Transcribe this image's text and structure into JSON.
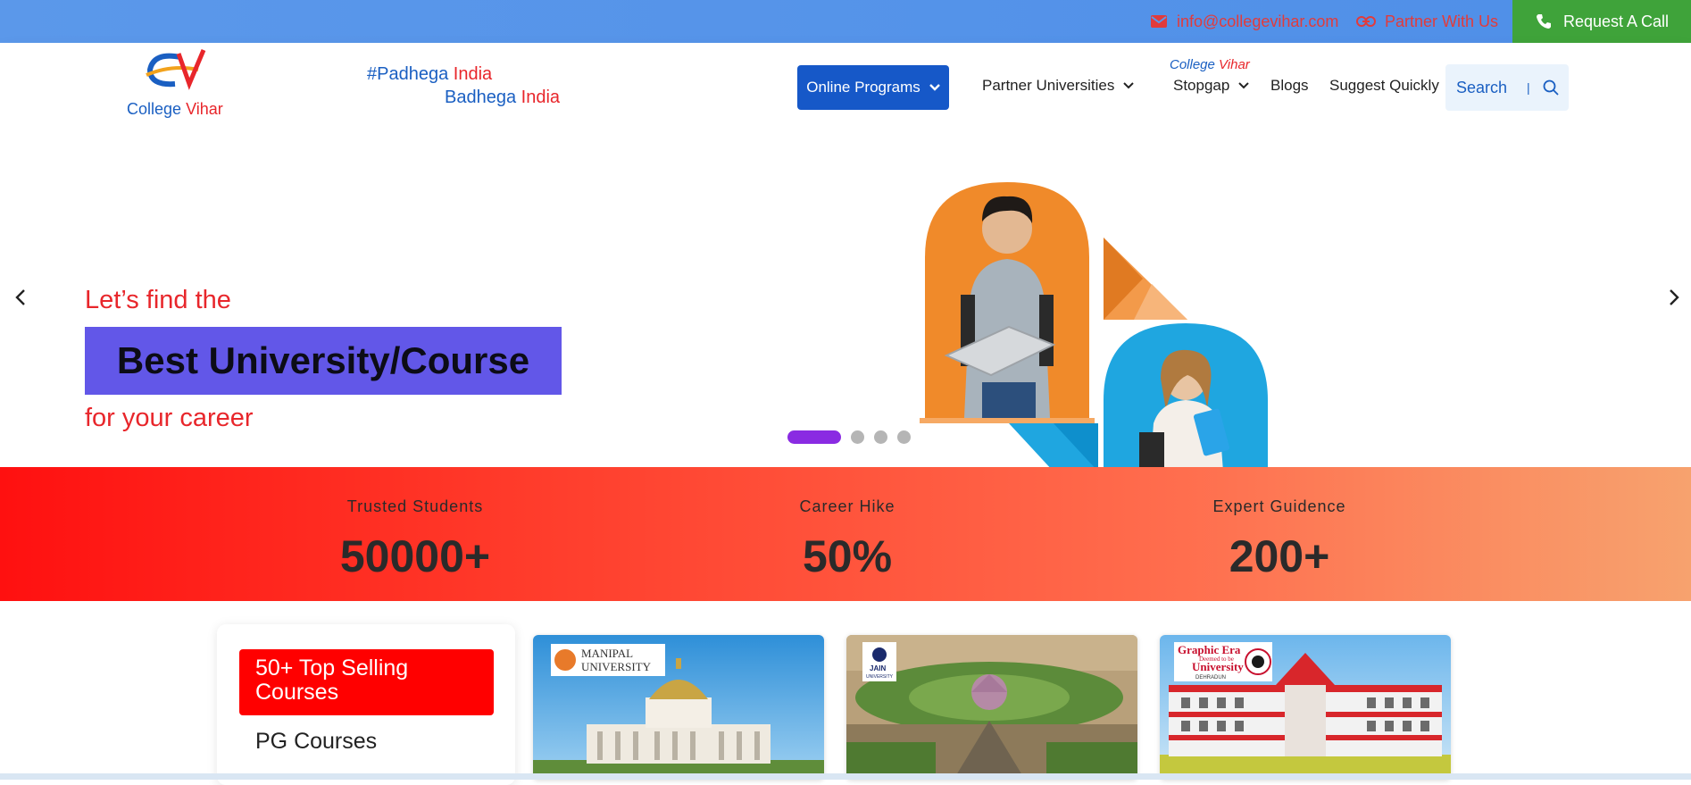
{
  "topbar": {
    "email": "info@collegevihar.com",
    "partner": "Partner With Us",
    "request_call": "Request A Call"
  },
  "brand": {
    "part1": "College",
    "part2": "Vihar",
    "logo_text": "CV"
  },
  "tagline": {
    "line1_a": "#Padhega",
    "line1_b": "India",
    "line2_a": "Badhega",
    "line2_b": "India"
  },
  "nav": {
    "online_programs": "Online Programs",
    "partner_universities": "Partner Universities",
    "stopgap_brand_a": "College",
    "stopgap_brand_b": "Vihar",
    "stopgap": "Stopgap",
    "blogs": "Blogs",
    "suggest": "Suggest Quickly",
    "search": "Search",
    "search_sep": "|"
  },
  "hero": {
    "line1": "Let’s find the",
    "highlight": "Best University/Course",
    "line3": "for your career",
    "slides_total": 4,
    "active_slide": 1
  },
  "stats": [
    {
      "label": "Trusted Students",
      "value": "50000+"
    },
    {
      "label": "Career Hike",
      "value": "50%"
    },
    {
      "label": "Expert Guidence",
      "value": "200+"
    }
  ],
  "courses_panel": {
    "top_selling_line1": "50+ Top Selling",
    "top_selling_line2": "Courses",
    "pg": "PG Courses"
  },
  "university_cards": [
    {
      "logo_text_1": "MANIPAL",
      "logo_text_2": "UNIVERSITY"
    },
    {
      "logo_text_1": "JAIN",
      "logo_text_2": "UNIVERSITY"
    },
    {
      "logo_text_1": "Graphic Era",
      "logo_text_2": "University",
      "logo_text_3": "Deemed to be",
      "logo_text_4": "DEHRADUN"
    }
  ],
  "colors": {
    "topbar": "#5b98ea",
    "accent_red": "#e8262b",
    "brand_blue": "#1a5fc2",
    "call_green": "#3fa33a",
    "highlight_box": "#6257e8",
    "active_dot": "#8a2be2"
  },
  "icons": [
    "envelope-icon",
    "link-icon",
    "phone-icon",
    "chevron-down-icon",
    "search-icon",
    "chevron-left-icon",
    "chevron-right-icon"
  ]
}
